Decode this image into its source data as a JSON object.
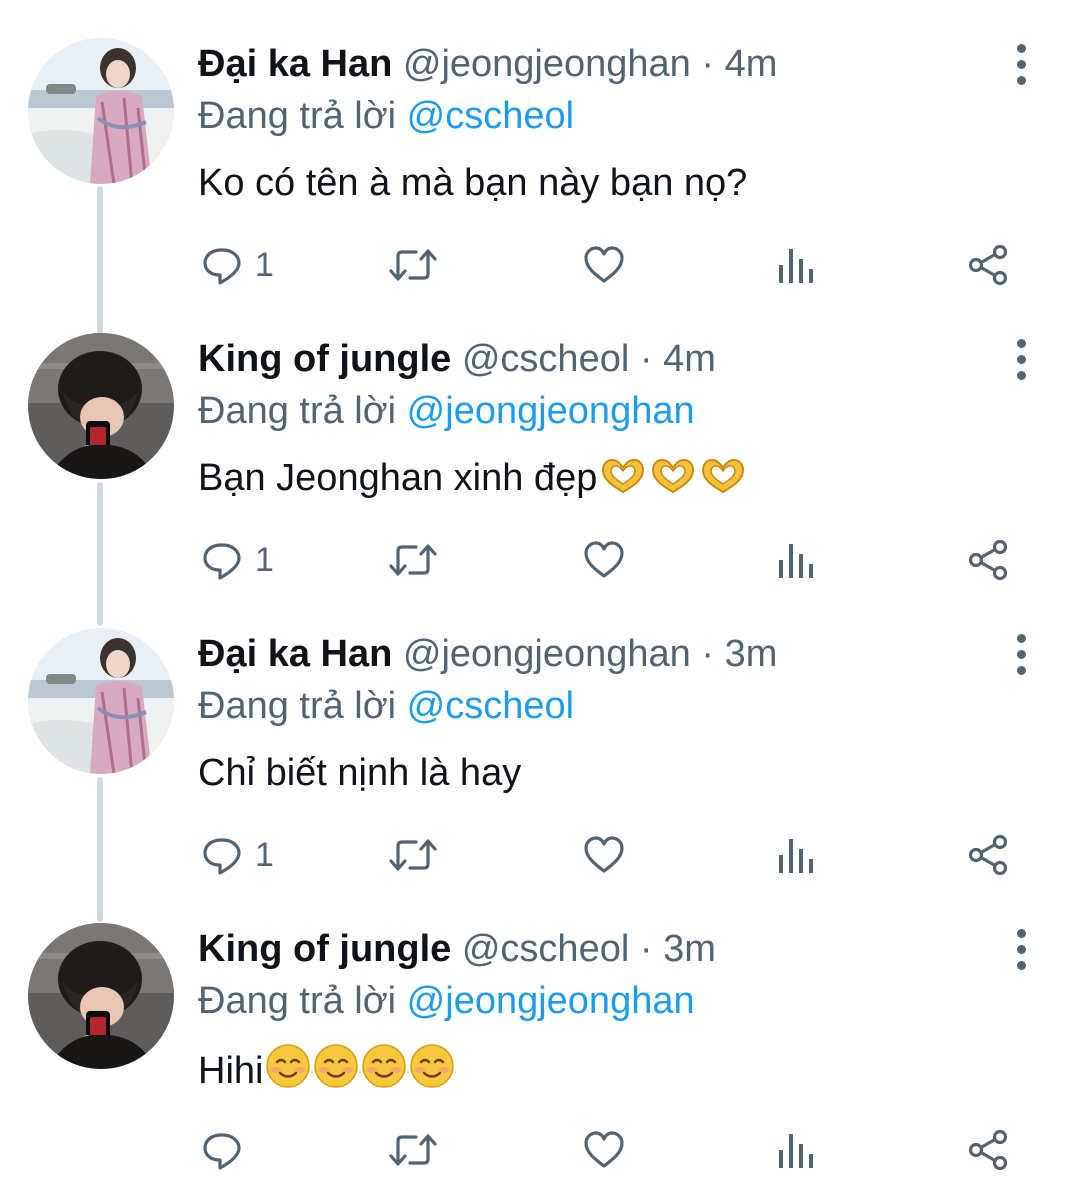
{
  "tweets": [
    {
      "name": "Đại ka Han",
      "handle": "@jeongjeonghan",
      "separator": "·",
      "time": "4m",
      "replying_prefix": "Đang trả lời",
      "replying_to": "@cscheol",
      "text": "Ko có tên à mà bạn này bạn nọ?",
      "reply_count": "1",
      "avatar": "beach-portrait",
      "emoji": []
    },
    {
      "name": "King of jungle",
      "handle": "@cscheol",
      "separator": "·",
      "time": "4m",
      "replying_prefix": "Đang trả lời",
      "replying_to": "@jeongjeonghan",
      "text": "Bạn Jeonghan xinh đẹp",
      "reply_count": "1",
      "avatar": "mirror-selfie",
      "emoji": [
        "heart-hands",
        "heart-hands",
        "heart-hands"
      ]
    },
    {
      "name": "Đại ka Han",
      "handle": "@jeongjeonghan",
      "separator": "·",
      "time": "3m",
      "replying_prefix": "Đang trả lời",
      "replying_to": "@cscheol",
      "text": "Chỉ biết nịnh là hay",
      "reply_count": "1",
      "avatar": "beach-portrait",
      "emoji": []
    },
    {
      "name": "King of jungle",
      "handle": "@cscheol",
      "separator": "·",
      "time": "3m",
      "replying_prefix": "Đang trả lời",
      "replying_to": "@jeongjeonghan",
      "text": "Hihi",
      "reply_count": "",
      "avatar": "mirror-selfie",
      "emoji": [
        "smiling-face",
        "smiling-face",
        "smiling-face",
        "smiling-face"
      ]
    }
  ],
  "colors": {
    "text": "#0f1419",
    "secondary": "#536471",
    "link": "#1d9bf0",
    "thread_line": "#cfd9de"
  },
  "icons": [
    "reply-icon",
    "retweet-icon",
    "like-icon",
    "views-icon",
    "share-icon",
    "more-icon"
  ]
}
